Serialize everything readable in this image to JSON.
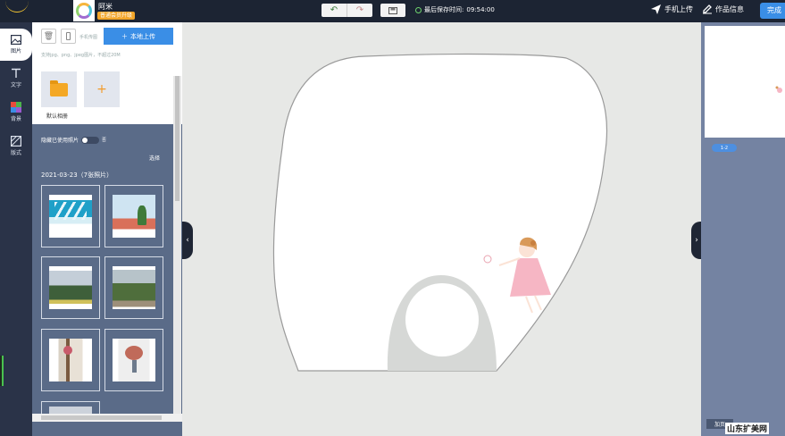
{
  "user": {
    "name": "阿米",
    "vip_badge": "普通会员升级"
  },
  "toolbar": {
    "undo_icon": "undo-icon",
    "redo_icon": "redo-icon",
    "save_icon": "save-icon",
    "autosave_label": "最后保存时间:",
    "autosave_time": "09:54:00",
    "phone_upload": "手机上传",
    "work_info": "作品信息",
    "finish": "完成"
  },
  "tools": [
    {
      "label": "图片",
      "icon": "image-icon"
    },
    {
      "label": "文字",
      "icon": "text-icon"
    },
    {
      "label": "背景",
      "icon": "palette-icon"
    },
    {
      "label": "版式",
      "icon": "layout-icon"
    }
  ],
  "photos_panel": {
    "phone_label": "手机传图",
    "local_upload": "本地上传",
    "support_text": "支持jpg、png、jpeg图片，不超过20M",
    "default_folder": "默认相册",
    "add_folder_symbol": "+",
    "hide_used_label": "隐藏已使用照片",
    "toggle_label": "否",
    "select_label": "选择",
    "date_group": "2021-03-23（7张照片）"
  },
  "canvas": {
    "background": "#e7e8e6",
    "product_outline": "#8f8f8f"
  },
  "pages": {
    "page_badge": "1-2",
    "add_page": "加页"
  },
  "watermark": "山东扩美网",
  "colors": {
    "accent": "#3a8ee6",
    "topbar": "#1c2433",
    "sidebar": "#2a3348",
    "panel": "#5a6b88"
  }
}
